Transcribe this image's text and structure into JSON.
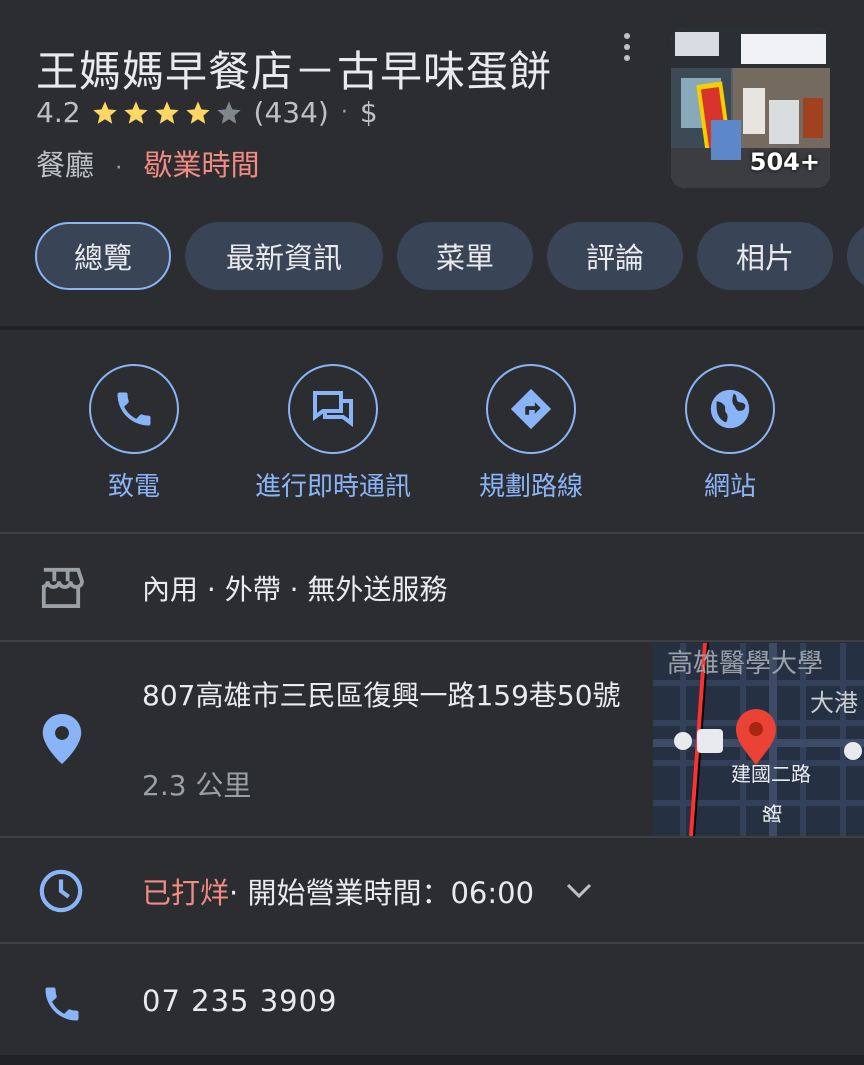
{
  "place": {
    "name": "王媽媽早餐店－古早味蛋餅",
    "rating": "4.2",
    "stars_filled": 4,
    "review_count": "(434)",
    "price_sep": "·",
    "price": "$",
    "category": "餐廳",
    "category_sep": "·",
    "hours_link": "歇業時間",
    "photo_count": "504+"
  },
  "tabs": [
    {
      "label": "總覽"
    },
    {
      "label": "最新資訊"
    },
    {
      "label": "菜單"
    },
    {
      "label": "評論"
    },
    {
      "label": "相片"
    }
  ],
  "actions": [
    {
      "label": "致電",
      "icon": "phone-icon"
    },
    {
      "label": "進行即時通訊",
      "icon": "chat-icon"
    },
    {
      "label": "規劃路線",
      "icon": "directions-icon"
    },
    {
      "label": "網站",
      "icon": "globe-icon"
    }
  ],
  "service_options": "內用 · 外帶 · 無外送服務",
  "address": {
    "line": "807高雄市三民區復興一路159巷50號",
    "distance": "2.3 公里"
  },
  "map": {
    "label_top": "高雄醫學大學",
    "label_right": "大港",
    "label_road": "建國二路",
    "label_road2": "路"
  },
  "hours": {
    "status": "已打烊",
    "detail": " · 開始營業時間：06:00"
  },
  "phone": "07 235 3909",
  "colors": {
    "accent": "#8ab4f8",
    "closed": "#f28b82",
    "star": "#fdd663",
    "background": "#2c2d30"
  }
}
